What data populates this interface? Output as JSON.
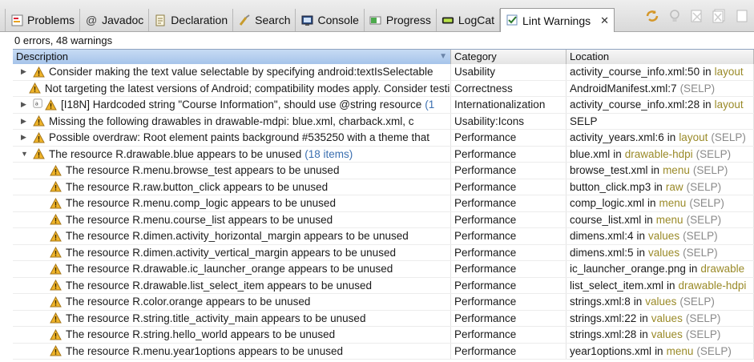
{
  "tabs": [
    {
      "label": "Problems",
      "icon": "problems-icon"
    },
    {
      "label": "Javadoc",
      "icon": "at-icon"
    },
    {
      "label": "Declaration",
      "icon": "declaration-icon"
    },
    {
      "label": "Search",
      "icon": "search-icon"
    },
    {
      "label": "Console",
      "icon": "console-icon"
    },
    {
      "label": "Progress",
      "icon": "progress-icon"
    },
    {
      "label": "LogCat",
      "icon": "logcat-icon"
    },
    {
      "label": "Lint Warnings",
      "icon": "lint-icon",
      "active": true
    }
  ],
  "status": "0 errors, 48 warnings",
  "columns": {
    "description": "Description",
    "category": "Category",
    "location": "Location"
  },
  "rows": [
    {
      "expand": "collapsed",
      "extra_icon": false,
      "desc": "Consider making the text value selectable by specifying android:textIsSelectable",
      "count": "",
      "category": "Usability",
      "file": "activity_course_info.xml:50",
      "folder": "layout",
      "project": ""
    },
    {
      "expand": "none",
      "extra_icon": false,
      "desc": "Not targeting the latest versions of Android; compatibility modes apply. Consider testing",
      "count": "",
      "category": "Correctness",
      "file": "AndroidManifest.xml:7",
      "folder": "",
      "project": "(SELP)"
    },
    {
      "expand": "collapsed",
      "extra_icon": true,
      "desc": "[I18N] Hardcoded string \"Course Information\", should use @string resource",
      "count": "(1",
      "category": "Internationalization",
      "file": "activity_course_info.xml:28",
      "folder": "layout",
      "project": ""
    },
    {
      "expand": "collapsed",
      "extra_icon": false,
      "desc": "Missing the following drawables in drawable-mdpi: blue.xml, charback.xml, c",
      "count": "",
      "category": "Usability:Icons",
      "file": "SELP",
      "folder": "",
      "project": ""
    },
    {
      "expand": "collapsed",
      "extra_icon": false,
      "desc": "Possible overdraw: Root element paints background #535250 with a theme that",
      "count": "",
      "category": "Performance",
      "file": "activity_years.xml:6",
      "folder": "layout",
      "project": "(SELP)"
    },
    {
      "expand": "expanded",
      "extra_icon": false,
      "desc": "The resource R.drawable.blue appears to be unused",
      "count": "(18 items)",
      "category": "Performance",
      "file": "blue.xml",
      "folder": "drawable-hdpi",
      "project": "(SELP)"
    },
    {
      "child": true,
      "desc": "The resource R.menu.browse_test appears to be unused",
      "category": "Performance",
      "file": "browse_test.xml",
      "folder": "menu",
      "project": "(SELP)"
    },
    {
      "child": true,
      "desc": "The resource R.raw.button_click appears to be unused",
      "category": "Performance",
      "file": "button_click.mp3",
      "folder": "raw",
      "project": "(SELP)"
    },
    {
      "child": true,
      "desc": "The resource R.menu.comp_logic appears to be unused",
      "category": "Performance",
      "file": "comp_logic.xml",
      "folder": "menu",
      "project": "(SELP)"
    },
    {
      "child": true,
      "desc": "The resource R.menu.course_list appears to be unused",
      "category": "Performance",
      "file": "course_list.xml",
      "folder": "menu",
      "project": "(SELP)"
    },
    {
      "child": true,
      "desc": "The resource R.dimen.activity_horizontal_margin appears to be unused",
      "category": "Performance",
      "file": "dimens.xml:4",
      "folder": "values",
      "project": "(SELP)"
    },
    {
      "child": true,
      "desc": "The resource R.dimen.activity_vertical_margin appears to be unused",
      "category": "Performance",
      "file": "dimens.xml:5",
      "folder": "values",
      "project": "(SELP)"
    },
    {
      "child": true,
      "desc": "The resource R.drawable.ic_launcher_orange appears to be unused",
      "category": "Performance",
      "file": "ic_launcher_orange.png",
      "folder": "drawable",
      "project": ""
    },
    {
      "child": true,
      "desc": "The resource R.drawable.list_select_item appears to be unused",
      "category": "Performance",
      "file": "list_select_item.xml",
      "folder": "drawable-hdpi",
      "project": ""
    },
    {
      "child": true,
      "desc": "The resource R.color.orange appears to be unused",
      "category": "Performance",
      "file": "strings.xml:8",
      "folder": "values",
      "project": "(SELP)"
    },
    {
      "child": true,
      "desc": "The resource R.string.title_activity_main appears to be unused",
      "category": "Performance",
      "file": "strings.xml:22",
      "folder": "values",
      "project": "(SELP)"
    },
    {
      "child": true,
      "desc": "The resource R.string.hello_world appears to be unused",
      "category": "Performance",
      "file": "strings.xml:28",
      "folder": "values",
      "project": "(SELP)"
    },
    {
      "child": true,
      "desc": "The resource R.menu.year1options appears to be unused",
      "category": "Performance",
      "file": "year1options.xml",
      "folder": "menu",
      "project": "(SELP)"
    }
  ],
  "in_word": "in",
  "colors": {
    "warning": "#f0b429",
    "folder": "#9a8a28",
    "count": "#3b6fb0",
    "header_selected": "#b5cdee"
  }
}
